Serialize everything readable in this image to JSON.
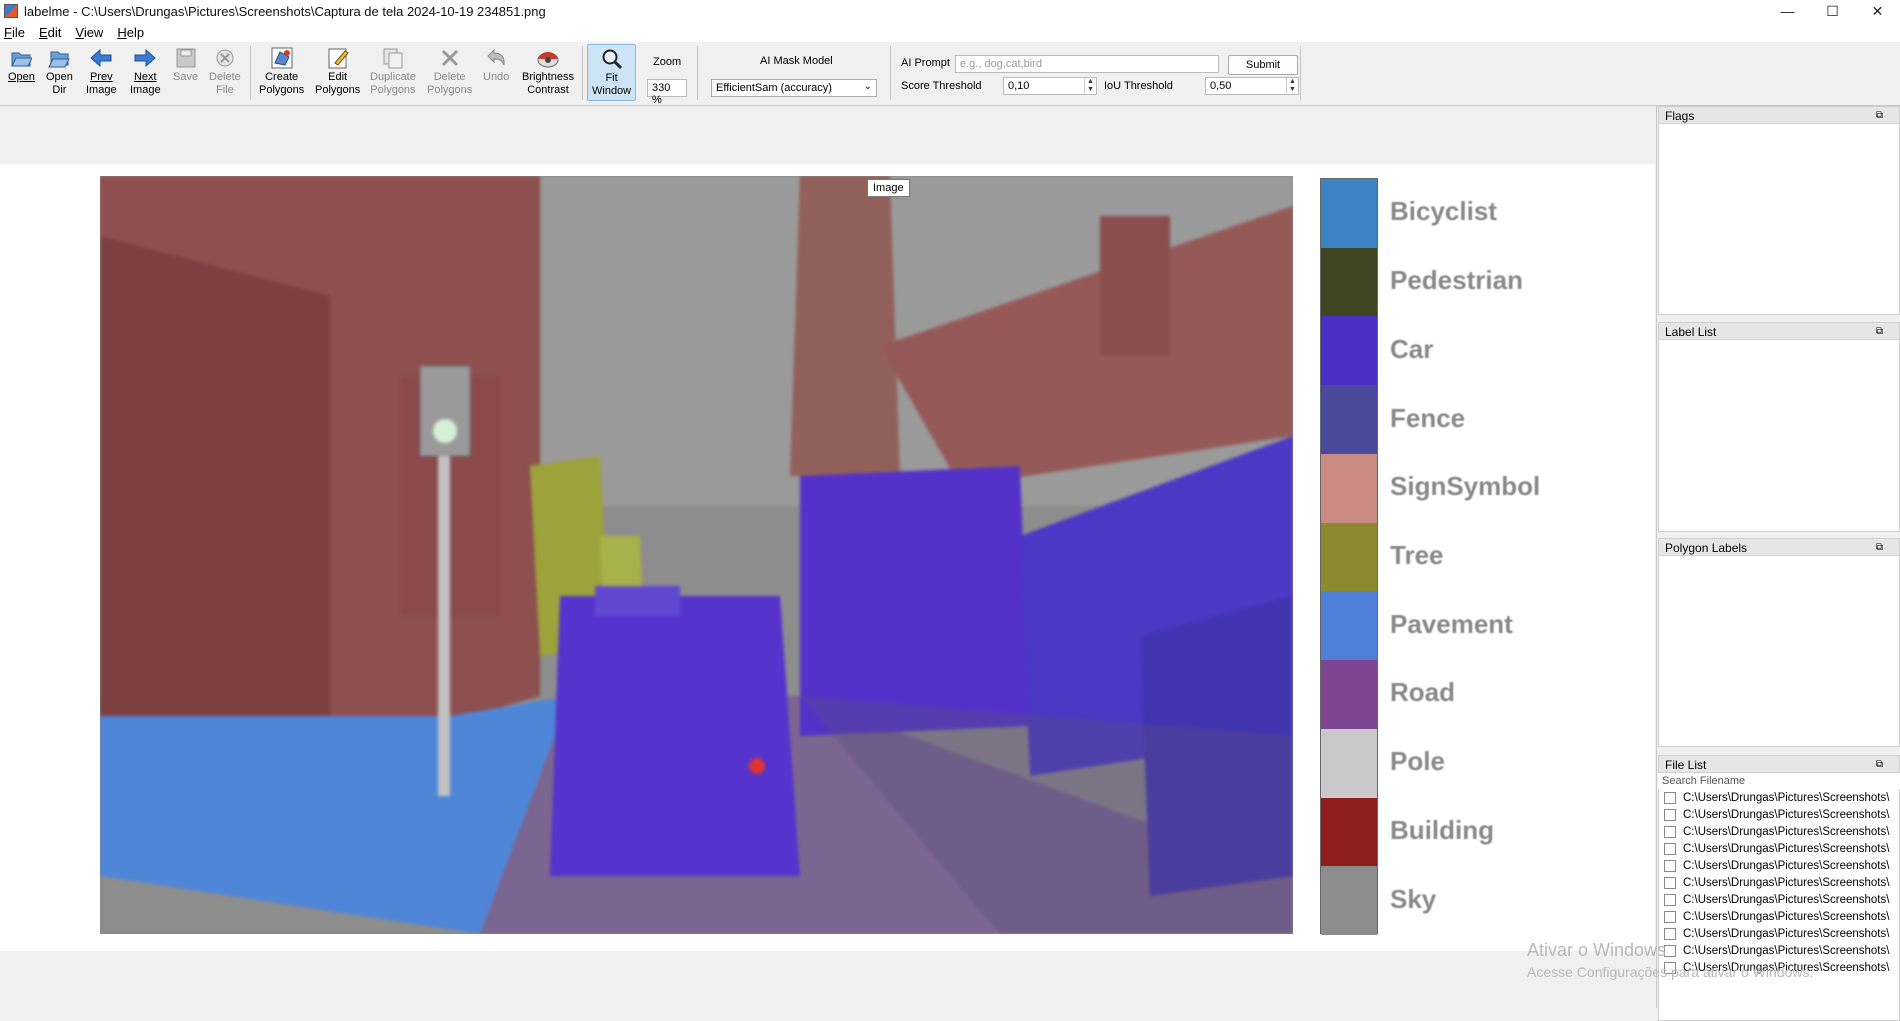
{
  "window": {
    "title": "labelme - C:\\Users\\Drungas\\Pictures\\Screenshots\\Captura de tela 2024-10-19 234851.png",
    "minimize": "—",
    "maximize": "☐",
    "close": "✕"
  },
  "menu": [
    {
      "ul": "F",
      "rest": "ile"
    },
    {
      "ul": "E",
      "rest": "dit"
    },
    {
      "ul": "V",
      "rest": "iew"
    },
    {
      "ul": "H",
      "rest": "elp"
    }
  ],
  "toolbar": {
    "open": "Open",
    "open_dir": [
      "Open",
      "Dir"
    ],
    "prev_image": [
      "Prev",
      "Image"
    ],
    "next_image": [
      "Next",
      "Image"
    ],
    "save": "Save",
    "delete_file": [
      "Delete",
      "File"
    ],
    "create_polygons": [
      "Create",
      "Polygons"
    ],
    "edit_polygons": [
      "Edit",
      "Polygons"
    ],
    "duplicate_polygons": [
      "Duplicate",
      "Polygons"
    ],
    "delete_polygons": [
      "Delete",
      "Polygons"
    ],
    "undo": "Undo",
    "brightness_contrast": [
      "Brightness",
      "Contrast"
    ],
    "fit_window": [
      "Fit",
      "Window"
    ],
    "zoom_label": "Zoom",
    "zoom_value": "330 %",
    "ai_mask_model_label": "AI Mask Model",
    "ai_mask_model_value": "EfficientSam (accuracy)",
    "ai_prompt_label": "AI Prompt",
    "ai_prompt_placeholder": "e.g., dog,cat,bird",
    "submit": "Submit",
    "score_threshold_label": "Score Threshold",
    "score_threshold_value": "0,10",
    "iou_threshold_label": "IoU Threshold",
    "iou_threshold_value": "0,50"
  },
  "canvas": {
    "tooltip": "Image",
    "legend": [
      {
        "label": "Bicyclist",
        "color": "#3b83c3"
      },
      {
        "label": "Pedestrian",
        "color": "#3f4520"
      },
      {
        "label": "Car",
        "color": "#4a2fc4"
      },
      {
        "label": "Fence",
        "color": "#4a4a9c"
      },
      {
        "label": "SignSymbol",
        "color": "#c98a82"
      },
      {
        "label": "Tree",
        "color": "#8c8a2f"
      },
      {
        "label": "Pavement",
        "color": "#4f7fd8"
      },
      {
        "label": "Road",
        "color": "#7e4690"
      },
      {
        "label": "Pole",
        "color": "#c9c9c9"
      },
      {
        "label": "Building",
        "color": "#8e1d1d"
      },
      {
        "label": "Sky",
        "color": "#8d8d8d"
      }
    ]
  },
  "docks": {
    "flags": "Flags",
    "label_list": "Label List",
    "polygon_labels": "Polygon Labels",
    "file_list": "File List",
    "search_placeholder": "Search Filename",
    "files": [
      "C:\\Users\\Drungas\\Pictures\\Screenshots\\",
      "C:\\Users\\Drungas\\Pictures\\Screenshots\\",
      "C:\\Users\\Drungas\\Pictures\\Screenshots\\",
      "C:\\Users\\Drungas\\Pictures\\Screenshots\\",
      "C:\\Users\\Drungas\\Pictures\\Screenshots\\",
      "C:\\Users\\Drungas\\Pictures\\Screenshots\\",
      "C:\\Users\\Drungas\\Pictures\\Screenshots\\",
      "C:\\Users\\Drungas\\Pictures\\Screenshots\\",
      "C:\\Users\\Drungas\\Pictures\\Screenshots\\",
      "C:\\Users\\Drungas\\Pictures\\Screenshots\\",
      "C:\\Users\\Drungas\\Pictures\\Screenshots\\"
    ]
  },
  "watermark": {
    "line1": "Ativar o Windows",
    "line2": "Acesse Configurações para ativar o Windows."
  }
}
